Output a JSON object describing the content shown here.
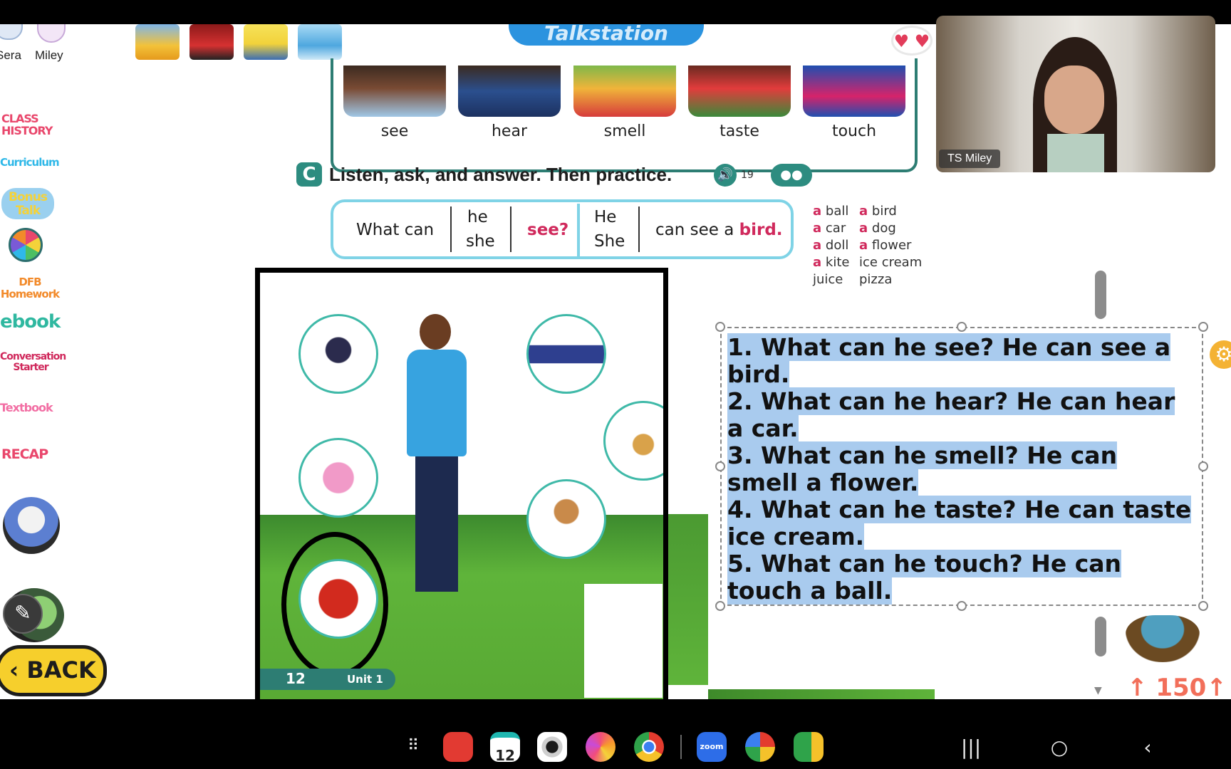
{
  "toolbar": {
    "participants": [
      {
        "label": "Sera"
      },
      {
        "label": "Miley"
      }
    ],
    "title": "Talkstation"
  },
  "sidebar": {
    "items": [
      {
        "label": "CLASS HISTORY"
      },
      {
        "label": "Curriculum"
      },
      {
        "label": "Bonus Talk"
      },
      {
        "label": "DFB Homework"
      },
      {
        "label": "ebook"
      },
      {
        "label": "Conversation Starter"
      },
      {
        "label": "Textbook"
      },
      {
        "label": "RECAP"
      }
    ],
    "back_label": "BACK"
  },
  "lesson": {
    "senses": [
      "see",
      "hear",
      "smell",
      "taste",
      "touch"
    ],
    "section_letter": "C",
    "instruction": "Listen, ask, and answer. Then practice.",
    "audio_track": "19",
    "pattern": {
      "q1": "What can",
      "q2a": "he",
      "q2b": "she",
      "q3": "see?",
      "a1a": "He",
      "a1b": "She",
      "a2": "can see a",
      "a3": "bird."
    },
    "vocab": [
      [
        "a",
        "ball"
      ],
      [
        "a",
        "bird"
      ],
      [
        "a",
        "car"
      ],
      [
        "a",
        "dog"
      ],
      [
        "a",
        "doll"
      ],
      [
        "a",
        "flower"
      ],
      [
        "a",
        "kite"
      ],
      [
        "",
        "ice cream"
      ],
      [
        "",
        "juice"
      ],
      [
        "",
        "pizza"
      ]
    ],
    "page_number": "12",
    "unit": "Unit 1"
  },
  "answers": {
    "lines": [
      "1. What can he see? He can see a bird.",
      "2. What can he hear? He can hear a car.",
      "3. What can he smell? He can smell a flower.",
      "4. What can he taste? He can taste ice cream.",
      "5. What can he touch? He can touch a ball."
    ]
  },
  "score": "150",
  "video": {
    "name": "TS Miley"
  },
  "taskbar": {
    "calendar_day": "12",
    "apps": [
      {
        "name": "apps-grid-icon"
      },
      {
        "name": "notes-app-icon"
      },
      {
        "name": "calendar-app-icon"
      },
      {
        "name": "camera-app-icon"
      },
      {
        "name": "flower-app-icon"
      },
      {
        "name": "chrome-app-icon"
      },
      {
        "name": "zoom-app-icon",
        "label": "zoom"
      },
      {
        "name": "photos-app-icon"
      },
      {
        "name": "meet-app-icon"
      }
    ]
  },
  "colors": {
    "highlight": "#a9cbee",
    "accent": "#2b93df",
    "teal": "#3fb9a8",
    "pink": "#d0295c"
  }
}
